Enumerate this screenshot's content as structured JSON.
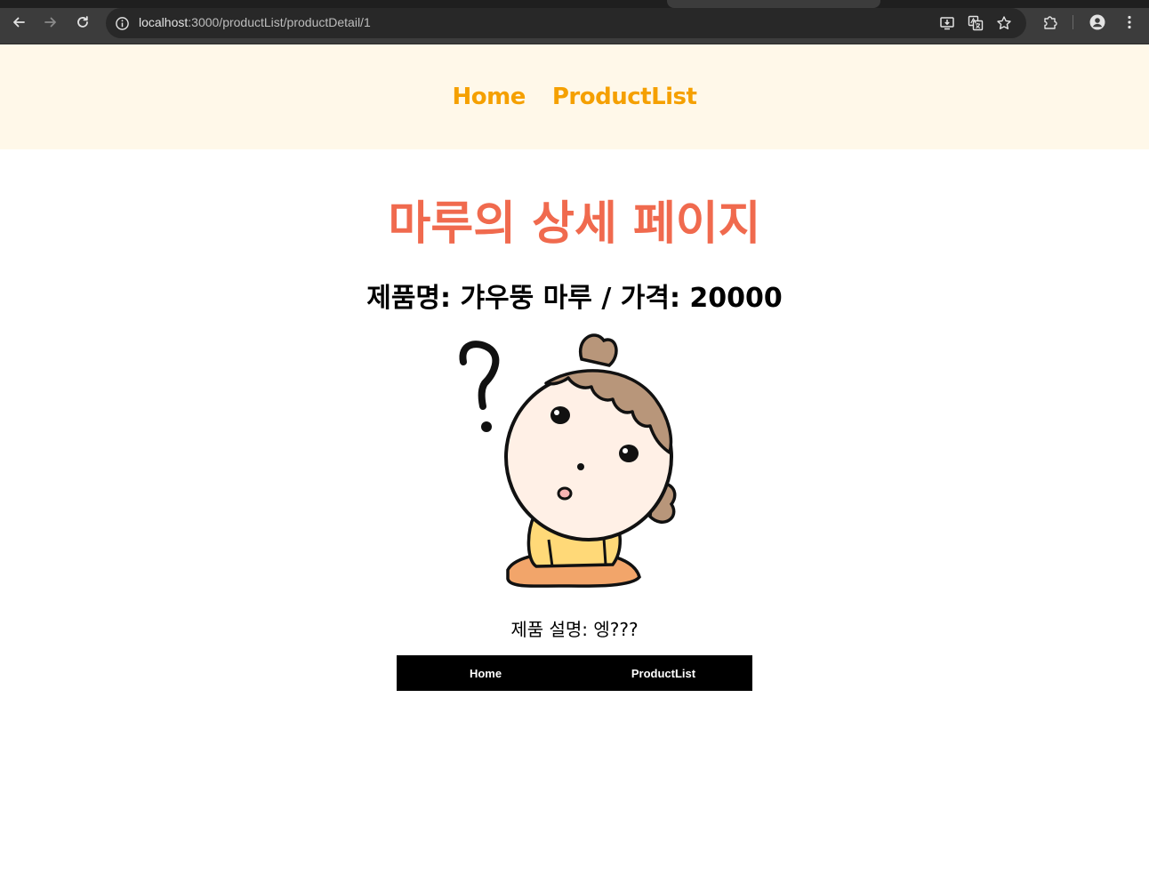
{
  "browser": {
    "url_host": "localhost",
    "url_path": ":3000/productList/productDetail/1",
    "icons": {
      "back": "back-arrow-icon",
      "forward": "forward-arrow-icon",
      "reload": "reload-icon",
      "site_info": "info-icon",
      "install": "install-app-icon",
      "translate": "translate-icon",
      "bookmark": "star-icon",
      "extensions": "puzzle-icon",
      "profile": "profile-icon",
      "menu": "more-vertical-icon"
    }
  },
  "header": {
    "links": [
      "Home",
      "ProductList"
    ],
    "link_color": "#f5a000",
    "background": "#fff8e9"
  },
  "main": {
    "title": "마루의 상세 페이지",
    "title_color": "#f06a4e",
    "product_line": "제품명: 갸우뚱 마루 / 가격: 20000",
    "description": "제품 설명: 엥???",
    "image": "confused-girl-illustration"
  },
  "footer": {
    "links": [
      "Home",
      "ProductList"
    ],
    "background": "#000000"
  }
}
